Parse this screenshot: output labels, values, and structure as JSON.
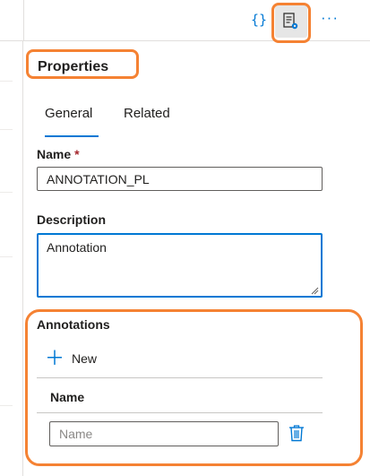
{
  "toolbar": {
    "code_icon": "{}",
    "more_icon": "···",
    "accent_color": "#0078d4",
    "highlight_color": "#f58233"
  },
  "properties": {
    "title": "Properties",
    "tabs": [
      {
        "label": "General",
        "selected": true
      },
      {
        "label": "Related",
        "selected": false
      }
    ],
    "name": {
      "label": "Name",
      "required_marker": "*",
      "value": "ANNOTATION_PL"
    },
    "description": {
      "label": "Description",
      "value": "Annotation"
    },
    "annotations": {
      "label": "Annotations",
      "new_label": "New",
      "column_header": "Name",
      "rows": [
        {
          "name_placeholder": "Name",
          "name_value": ""
        }
      ]
    }
  }
}
